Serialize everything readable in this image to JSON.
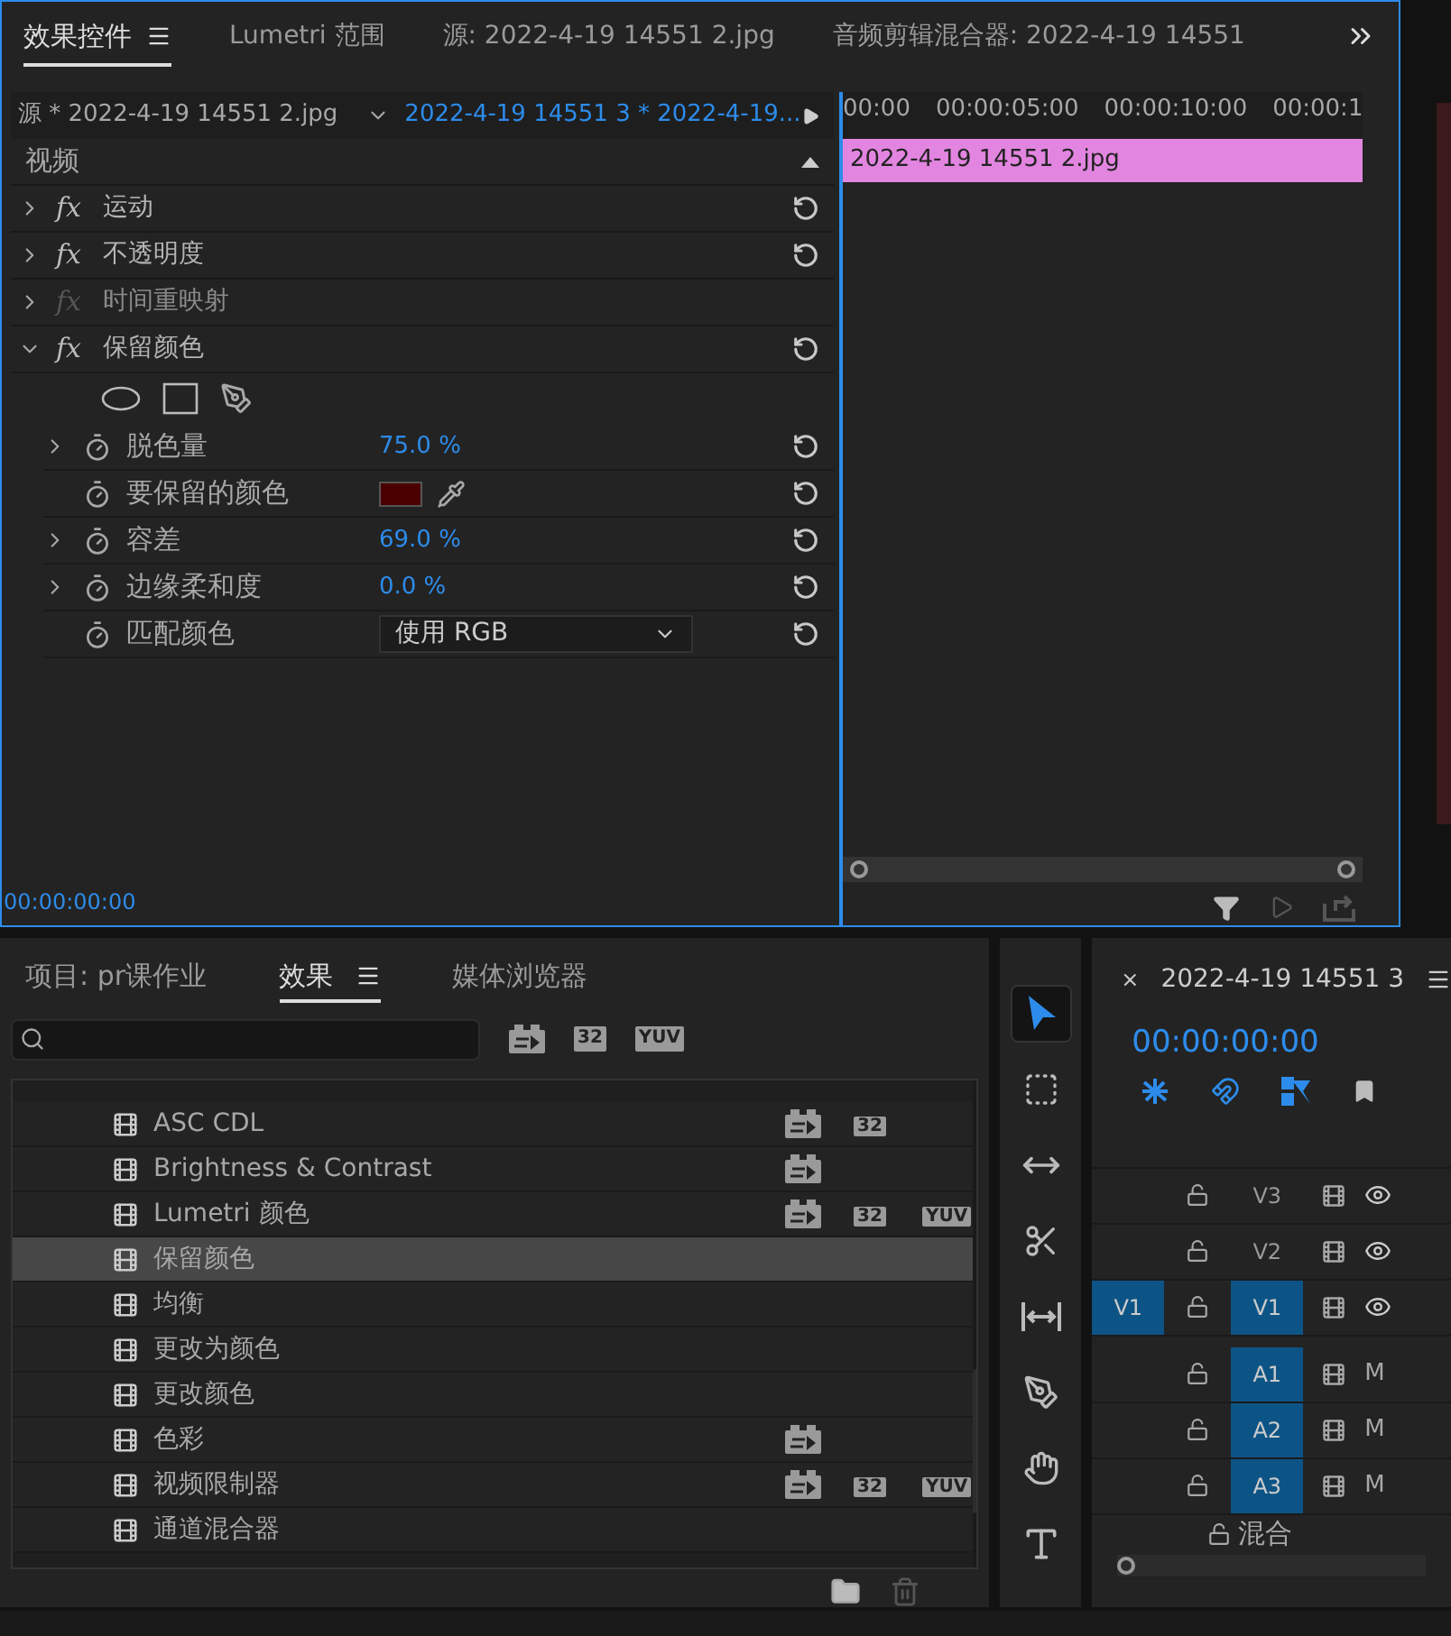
{
  "top_tabs": [
    {
      "label": "效果控件",
      "selected": true,
      "menu": true
    },
    {
      "label": "Lumetri 范围",
      "selected": false,
      "menu": false
    },
    {
      "label": "源: 2022-4-19 14551 2.jpg",
      "selected": false,
      "menu": false
    },
    {
      "label": "音频剪辑混合器: 2022-4-19 14551",
      "selected": false,
      "menu": false
    }
  ],
  "effect_controls": {
    "source_label": "源 * 2022-4-19 14551 2.jpg",
    "sequence_label": "2022-4-19 14551 3 * 2022-4-19...",
    "ruler": [
      "00:00",
      "00:00:05:00",
      "00:00:10:00",
      "00:00:1"
    ],
    "clip": "2022-4-19 14551 2.jpg",
    "section": "视频",
    "effects": [
      {
        "icon_text": "fx",
        "name": "运动",
        "expanded": false,
        "disabled": false
      },
      {
        "icon_text": "fx",
        "name": "不透明度",
        "expanded": false,
        "disabled": false
      },
      {
        "icon_text": "fx",
        "name": "时间重映射",
        "expanded": false,
        "disabled": true
      },
      {
        "icon_text": "fx",
        "name": "保留颜色",
        "expanded": true,
        "disabled": false
      }
    ],
    "params": [
      {
        "kind": "value",
        "name": "脱色量",
        "value": "75.0 %",
        "expandable": true
      },
      {
        "kind": "color",
        "name": "要保留的颜色",
        "color": "#4a0000",
        "expandable": false
      },
      {
        "kind": "value",
        "name": "容差",
        "value": "69.0 %",
        "expandable": true
      },
      {
        "kind": "value",
        "name": "边缘柔和度",
        "value": "0.0 %",
        "expandable": true
      },
      {
        "kind": "dropdown",
        "name": "匹配颜色",
        "value": "使用 RGB",
        "expandable": false
      }
    ],
    "timecode": "00:00:00:00"
  },
  "project_panel": {
    "tabs": [
      {
        "label": "项目: pr课作业",
        "selected": false,
        "menu": false
      },
      {
        "label": "效果",
        "selected": true,
        "menu": true
      },
      {
        "label": "媒体浏览器",
        "selected": false,
        "menu": false
      }
    ],
    "filter_badges": [
      {
        "kind": "accelerated"
      },
      {
        "kind": "bit32",
        "label": "32"
      },
      {
        "kind": "yuv",
        "label": "YUV"
      }
    ],
    "items": [
      {
        "name": "ASC CDL",
        "selected": false,
        "accelerated": true,
        "bit32": "32"
      },
      {
        "name": "Brightness & Contrast",
        "selected": false,
        "accelerated": true
      },
      {
        "name": "Lumetri 颜色",
        "selected": false,
        "accelerated": true,
        "bit32": "32",
        "yuv": "YUV"
      },
      {
        "name": "保留颜色",
        "selected": true
      },
      {
        "name": "均衡",
        "selected": false
      },
      {
        "name": "更改为颜色",
        "selected": false
      },
      {
        "name": "更改颜色",
        "selected": false
      },
      {
        "name": "色彩",
        "selected": false,
        "accelerated": true
      },
      {
        "name": "视频限制器",
        "selected": false,
        "accelerated": true,
        "bit32": "32",
        "yuv": "YUV"
      },
      {
        "name": "通道混合器",
        "selected": false
      }
    ]
  },
  "tools": [
    {
      "kind": "select",
      "selected": true
    },
    {
      "kind": "track-select",
      "selected": false
    },
    {
      "kind": "ripple",
      "selected": false
    },
    {
      "kind": "razor",
      "selected": false
    },
    {
      "kind": "slip",
      "selected": false
    },
    {
      "kind": "pen",
      "selected": false
    },
    {
      "kind": "hand",
      "selected": false
    },
    {
      "kind": "type",
      "selected": false
    }
  ],
  "timeline": {
    "close": "×",
    "title": "2022-4-19 14551 3",
    "timecode": "00:00:00:00",
    "tracks": [
      {
        "kind": "video",
        "label": "V3",
        "targeted": false
      },
      {
        "kind": "video",
        "label": "V2",
        "targeted": false
      },
      {
        "kind": "video",
        "label": "V1",
        "source": "V1",
        "targeted": true
      },
      {
        "kind": "audio",
        "label": "A1",
        "targeted": true,
        "mute": "M"
      },
      {
        "kind": "audio",
        "label": "A2",
        "targeted": true,
        "mute": "M"
      },
      {
        "kind": "audio",
        "label": "A3",
        "targeted": true,
        "mute": "M"
      }
    ],
    "mix": "混合"
  }
}
